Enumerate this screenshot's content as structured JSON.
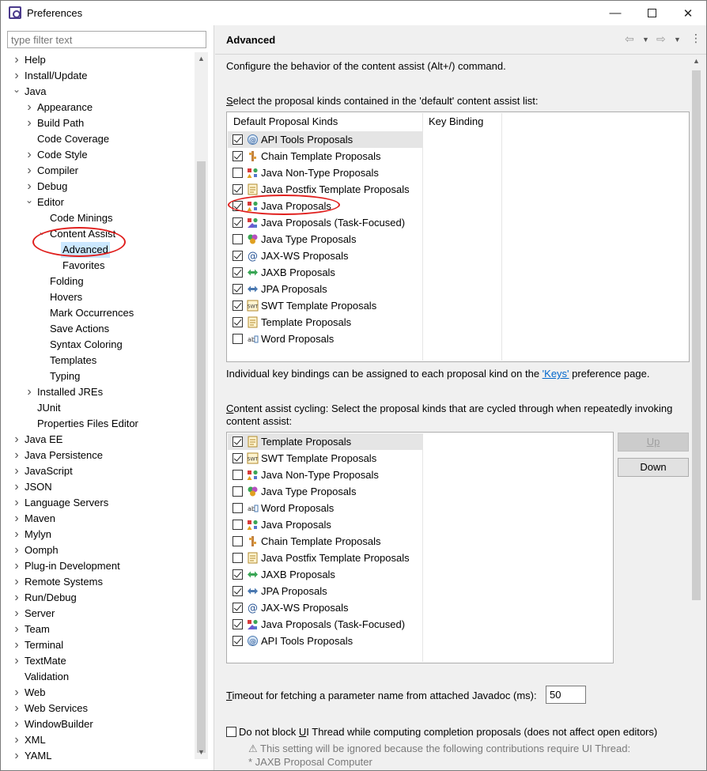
{
  "window": {
    "title": "Preferences"
  },
  "filter": {
    "placeholder": "type filter text"
  },
  "tree": [
    {
      "label": "Help",
      "level": 0,
      "twisty": ">"
    },
    {
      "label": "Install/Update",
      "level": 0,
      "twisty": ">"
    },
    {
      "label": "Java",
      "level": 0,
      "twisty": "v"
    },
    {
      "label": "Appearance",
      "level": 1,
      "twisty": ">"
    },
    {
      "label": "Build Path",
      "level": 1,
      "twisty": ">"
    },
    {
      "label": "Code Coverage",
      "level": 1,
      "twisty": ""
    },
    {
      "label": "Code Style",
      "level": 1,
      "twisty": ">"
    },
    {
      "label": "Compiler",
      "level": 1,
      "twisty": ">"
    },
    {
      "label": "Debug",
      "level": 1,
      "twisty": ">"
    },
    {
      "label": "Editor",
      "level": 1,
      "twisty": "v"
    },
    {
      "label": "Code Minings",
      "level": 2,
      "twisty": ""
    },
    {
      "label": "Content Assist",
      "level": 2,
      "twisty": "v"
    },
    {
      "label": "Advanced",
      "level": 3,
      "twisty": "",
      "selected": true
    },
    {
      "label": "Favorites",
      "level": 3,
      "twisty": ""
    },
    {
      "label": "Folding",
      "level": 2,
      "twisty": ""
    },
    {
      "label": "Hovers",
      "level": 2,
      "twisty": ""
    },
    {
      "label": "Mark Occurrences",
      "level": 2,
      "twisty": ""
    },
    {
      "label": "Save Actions",
      "level": 2,
      "twisty": ""
    },
    {
      "label": "Syntax Coloring",
      "level": 2,
      "twisty": ""
    },
    {
      "label": "Templates",
      "level": 2,
      "twisty": ""
    },
    {
      "label": "Typing",
      "level": 2,
      "twisty": ""
    },
    {
      "label": "Installed JREs",
      "level": 1,
      "twisty": ">"
    },
    {
      "label": "JUnit",
      "level": 1,
      "twisty": ""
    },
    {
      "label": "Properties Files Editor",
      "level": 1,
      "twisty": ""
    },
    {
      "label": "Java EE",
      "level": 0,
      "twisty": ">"
    },
    {
      "label": "Java Persistence",
      "level": 0,
      "twisty": ">"
    },
    {
      "label": "JavaScript",
      "level": 0,
      "twisty": ">"
    },
    {
      "label": "JSON",
      "level": 0,
      "twisty": ">"
    },
    {
      "label": "Language Servers",
      "level": 0,
      "twisty": ">"
    },
    {
      "label": "Maven",
      "level": 0,
      "twisty": ">"
    },
    {
      "label": "Mylyn",
      "level": 0,
      "twisty": ">"
    },
    {
      "label": "Oomph",
      "level": 0,
      "twisty": ">"
    },
    {
      "label": "Plug-in Development",
      "level": 0,
      "twisty": ">"
    },
    {
      "label": "Remote Systems",
      "level": 0,
      "twisty": ">"
    },
    {
      "label": "Run/Debug",
      "level": 0,
      "twisty": ">"
    },
    {
      "label": "Server",
      "level": 0,
      "twisty": ">"
    },
    {
      "label": "Team",
      "level": 0,
      "twisty": ">"
    },
    {
      "label": "Terminal",
      "level": 0,
      "twisty": ">"
    },
    {
      "label": "TextMate",
      "level": 0,
      "twisty": ">"
    },
    {
      "label": "Validation",
      "level": 0,
      "twisty": ""
    },
    {
      "label": "Web",
      "level": 0,
      "twisty": ">"
    },
    {
      "label": "Web Services",
      "level": 0,
      "twisty": ">"
    },
    {
      "label": "WindowBuilder",
      "level": 0,
      "twisty": ">"
    },
    {
      "label": "XML",
      "level": 0,
      "twisty": ">"
    },
    {
      "label": "YAML",
      "level": 0,
      "twisty": ">"
    }
  ],
  "page": {
    "title": "Advanced",
    "description": "Configure the behavior of the content assist (Alt+/) command.",
    "default_list_label": "Select the proposal kinds contained in the 'default' content assist list:",
    "default_list_mnemonic": "S",
    "default_list_rest": "elect the proposal kinds contained in the 'default' content assist list:",
    "col_kinds": "Default Proposal Kinds",
    "col_binding": "Key Binding",
    "default_proposals": [
      {
        "label": "API Tools Proposals",
        "checked": true,
        "icon": "api-tools-icon",
        "highlight": true
      },
      {
        "label": "Chain Template Proposals",
        "checked": true,
        "icon": "chain-template-icon"
      },
      {
        "label": "Java Non-Type Proposals",
        "checked": false,
        "icon": "java-non-type-icon"
      },
      {
        "label": "Java Postfix Template Proposals",
        "checked": true,
        "icon": "postfix-template-icon"
      },
      {
        "label": "Java Proposals",
        "checked": true,
        "icon": "java-proposals-icon"
      },
      {
        "label": "Java Proposals (Task-Focused)",
        "checked": true,
        "icon": "task-focused-icon"
      },
      {
        "label": "Java Type Proposals",
        "checked": false,
        "icon": "java-type-icon"
      },
      {
        "label": "JAX-WS Proposals",
        "checked": true,
        "icon": "jaxws-icon"
      },
      {
        "label": "JAXB Proposals",
        "checked": true,
        "icon": "jaxb-icon"
      },
      {
        "label": "JPA Proposals",
        "checked": true,
        "icon": "jpa-icon"
      },
      {
        "label": "SWT Template Proposals",
        "checked": true,
        "icon": "swt-template-icon"
      },
      {
        "label": "Template Proposals",
        "checked": true,
        "icon": "template-icon"
      },
      {
        "label": "Word Proposals",
        "checked": false,
        "icon": "word-icon"
      }
    ],
    "keys_note_pre": "Individual key bindings can be assigned to each proposal kind on the ",
    "keys_link": "'Keys'",
    "keys_note_post": " preference page.",
    "cycling_label_mnemonic": "C",
    "cycling_label_rest1": "ontent assist cycling: Select the proposal kinds that are cycled through when repeatedly invoking",
    "cycling_label_rest2": "content assist:",
    "cycling_proposals": [
      {
        "label": "Template Proposals",
        "checked": true,
        "icon": "template-icon",
        "highlight": true
      },
      {
        "label": "SWT Template Proposals",
        "checked": true,
        "icon": "swt-template-icon"
      },
      {
        "label": "Java Non-Type Proposals",
        "checked": false,
        "icon": "java-non-type-icon"
      },
      {
        "label": "Java Type Proposals",
        "checked": false,
        "icon": "java-type-icon"
      },
      {
        "label": "Word Proposals",
        "checked": false,
        "icon": "word-icon"
      },
      {
        "label": "Java Proposals",
        "checked": false,
        "icon": "java-proposals-icon"
      },
      {
        "label": "Chain Template Proposals",
        "checked": false,
        "icon": "chain-template-icon"
      },
      {
        "label": "Java Postfix Template Proposals",
        "checked": false,
        "icon": "postfix-template-icon"
      },
      {
        "label": "JAXB Proposals",
        "checked": true,
        "icon": "jaxb-icon"
      },
      {
        "label": "JPA Proposals",
        "checked": true,
        "icon": "jpa-icon"
      },
      {
        "label": "JAX-WS Proposals",
        "checked": true,
        "icon": "jaxws-icon"
      },
      {
        "label": "Java Proposals (Task-Focused)",
        "checked": true,
        "icon": "task-focused-icon"
      },
      {
        "label": "API Tools Proposals",
        "checked": true,
        "icon": "api-tools-icon"
      }
    ],
    "up_button": "Up",
    "down_button": "Down",
    "timeout_mnemonic": "T",
    "timeout_rest": "imeout for fetching a parameter name from attached Javadoc (ms):",
    "timeout_value": "50",
    "noblock_pre": "Do not block ",
    "noblock_mnemonic": "U",
    "noblock_post": "I Thread while computing completion proposals (does not affect open editors)",
    "noblock_checked": false,
    "warning_text": "This setting will be ignored because the following contributions require UI Thread:",
    "warning_item": "* JAXB Proposal Computer"
  },
  "colors": {
    "selection": "#cce8ff",
    "annotation": "#e0201e",
    "link": "#0066cc"
  }
}
